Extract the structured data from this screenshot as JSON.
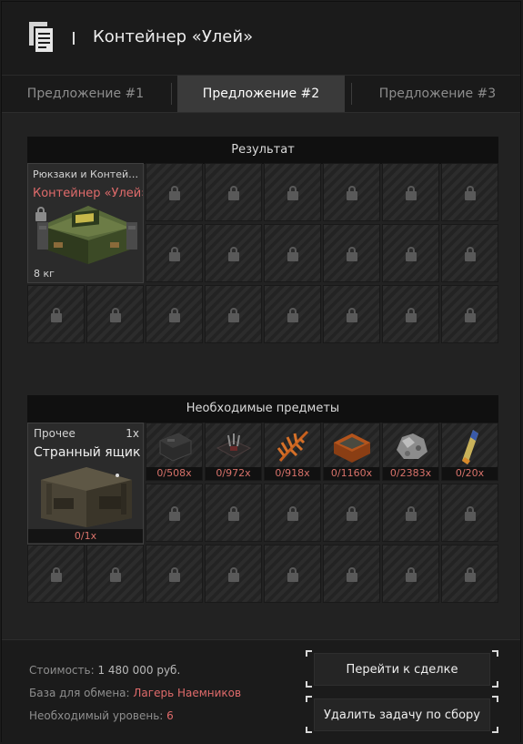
{
  "header": {
    "title": "Контейнер «Улей»",
    "icon": "document-icon"
  },
  "tabs": [
    {
      "label": "Предложение #1",
      "active": false
    },
    {
      "label": "Предложение #2",
      "active": true
    },
    {
      "label": "Предложение #3",
      "active": false
    }
  ],
  "result": {
    "title": "Результат",
    "item": {
      "category": "Рюкзаки и Контейне...",
      "name": "Контейнер «Улей»",
      "weight": "8 кг"
    }
  },
  "required": {
    "title": "Необходимые предметы",
    "main": {
      "category": "Прочее",
      "qty": "1x",
      "name": "Странный ящик",
      "count": "0/1x"
    },
    "items": [
      {
        "icon": "ammo-box-icon",
        "count": "0/508x"
      },
      {
        "icon": "circuit-board-icon",
        "count": "0/972x"
      },
      {
        "icon": "orange-fern-icon",
        "count": "0/918x"
      },
      {
        "icon": "orange-case-icon",
        "count": "0/1160x"
      },
      {
        "icon": "ore-rock-icon",
        "count": "0/2383x"
      },
      {
        "icon": "fuel-vial-icon",
        "count": "0/20x"
      }
    ]
  },
  "footer": {
    "cost_label": "Стоимость:",
    "cost_value": "1 480 000 руб.",
    "base_label": "База для обмена:",
    "base_value": "Лагерь Наемников",
    "level_label": "Необходимый уровень:",
    "level_value": "6",
    "go_button": "Перейти к сделке",
    "delete_button": "Удалить задачу по сбору"
  },
  "colors": {
    "accent_red": "#e06b6b",
    "counter_red": "#d9726a",
    "background": "#222222"
  }
}
